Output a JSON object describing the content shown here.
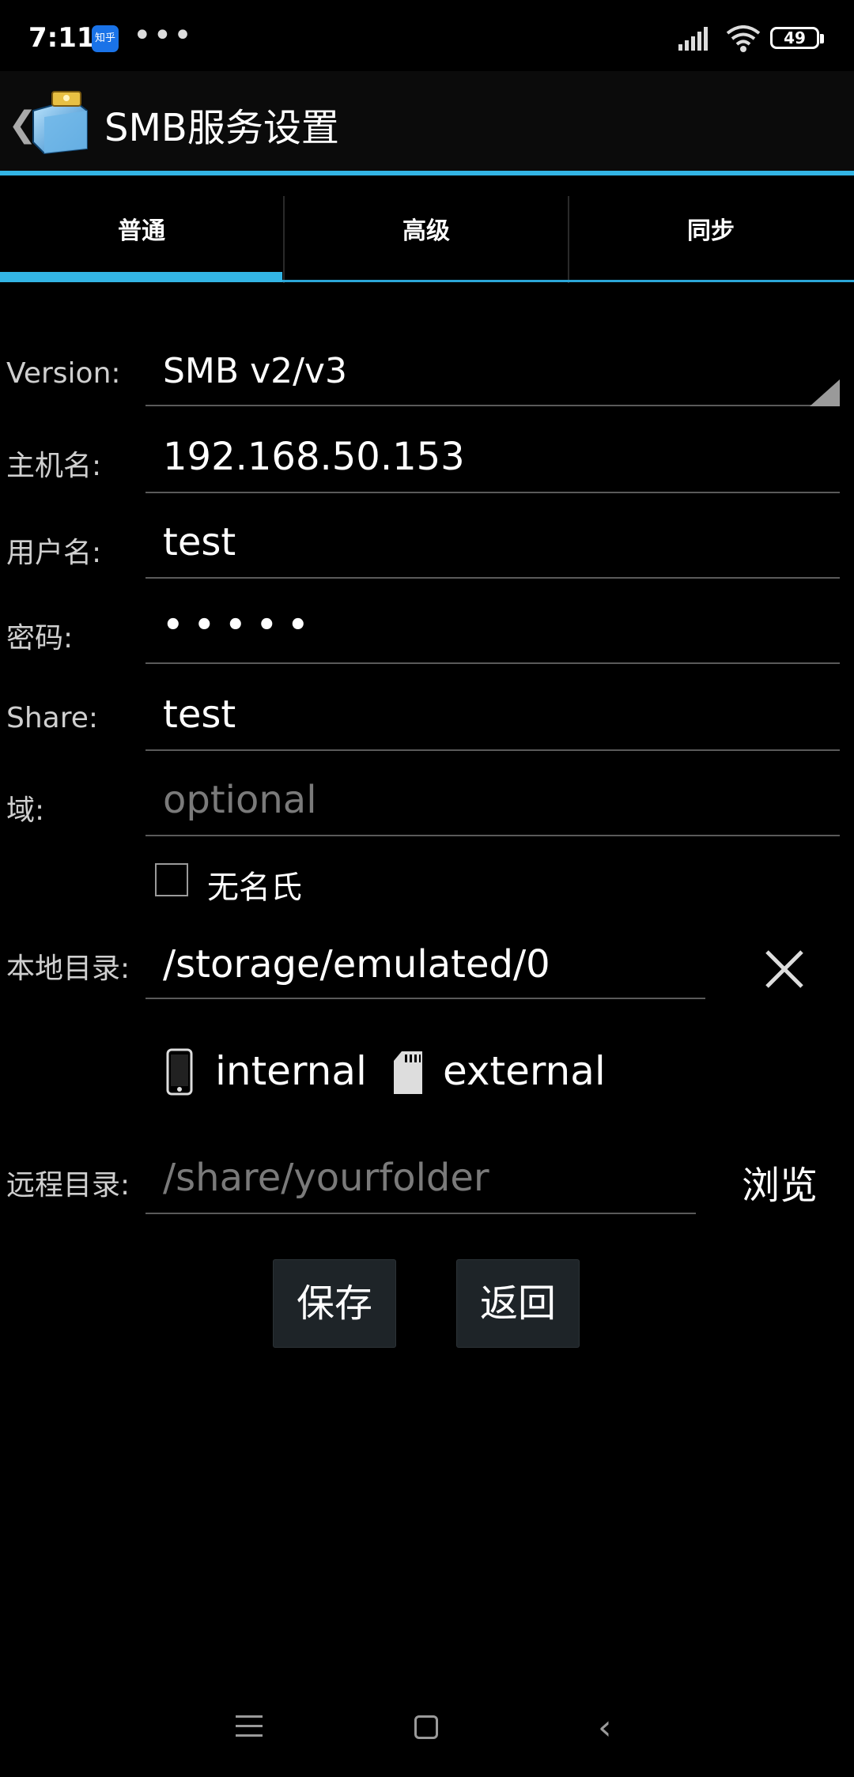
{
  "status_bar": {
    "time": "7:11",
    "zhihu_badge": "知乎",
    "more_dots": "•••",
    "battery": "49"
  },
  "action_bar": {
    "back": "❮",
    "title": "SMB服务设置"
  },
  "tabs": [
    {
      "label": "普通",
      "active": true
    },
    {
      "label": "高级",
      "active": false
    },
    {
      "label": "同步",
      "active": false
    }
  ],
  "form": {
    "version": {
      "label": "Version:",
      "value": "SMB v2/v3"
    },
    "host": {
      "label": "主机名:",
      "value": "192.168.50.153"
    },
    "username": {
      "label": "用户名:",
      "value": "test"
    },
    "password": {
      "label": "密码:",
      "value": "• • • • •"
    },
    "share": {
      "label": "Share:",
      "value": "test"
    },
    "domain": {
      "label": "域:",
      "placeholder": "optional"
    },
    "anonymous": {
      "label": "无名氏",
      "checked": false
    },
    "local_dir": {
      "label": "本地目录:",
      "value": "/storage/emulated/0"
    },
    "storage": {
      "internal": "internal",
      "external": "external"
    },
    "remote_dir": {
      "label": "远程目录:",
      "placeholder": "/share/yourfolder",
      "browse": "浏览"
    }
  },
  "buttons": {
    "save": "保存",
    "back": "返回"
  },
  "colors": {
    "accent": "#33b5e5",
    "background": "#000000",
    "button": "#1e2428"
  }
}
